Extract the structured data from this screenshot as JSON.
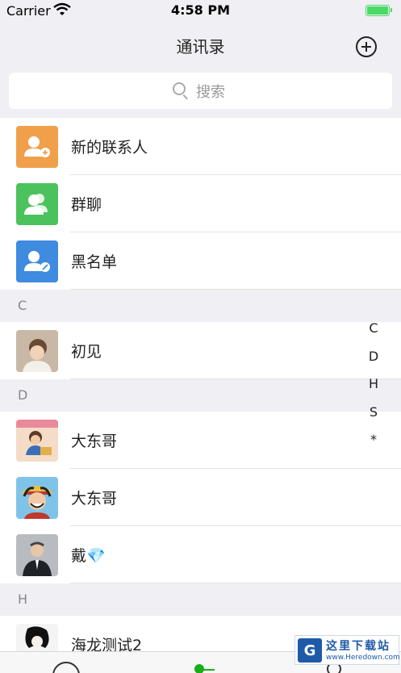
{
  "status_bar": {
    "carrier": "Carrier",
    "time": "4:58 PM",
    "battery_level": 1.0
  },
  "nav": {
    "title": "通讯录",
    "add_icon": "plus-circle-icon"
  },
  "search": {
    "placeholder": "搜索",
    "icon": "search-icon"
  },
  "functions": [
    {
      "label": "新的联系人",
      "icon": "new-contact-icon",
      "color": "#f0a04b"
    },
    {
      "label": "群聊",
      "icon": "group-chat-icon",
      "color": "#4cc25d"
    },
    {
      "label": "黑名单",
      "icon": "blacklist-icon",
      "color": "#3e8be0"
    }
  ],
  "sections": [
    {
      "letter": "C",
      "contacts": [
        {
          "name": "初见"
        }
      ]
    },
    {
      "letter": "D",
      "contacts": [
        {
          "name": "大东哥"
        },
        {
          "name": "大东哥"
        },
        {
          "name": "戴💎"
        }
      ]
    },
    {
      "letter": "H",
      "contacts": [
        {
          "name": "海龙测试2"
        }
      ]
    }
  ],
  "index_bar": [
    "C",
    "D",
    "H",
    "S",
    "*"
  ],
  "tab_bar": {
    "icons": [
      "chat-icon",
      "contacts-icon",
      "me-icon"
    ],
    "active": "contacts-icon",
    "accent": "#1aad19"
  },
  "watermark": {
    "title": "这里下载站",
    "url": "www.Heredown.com"
  }
}
